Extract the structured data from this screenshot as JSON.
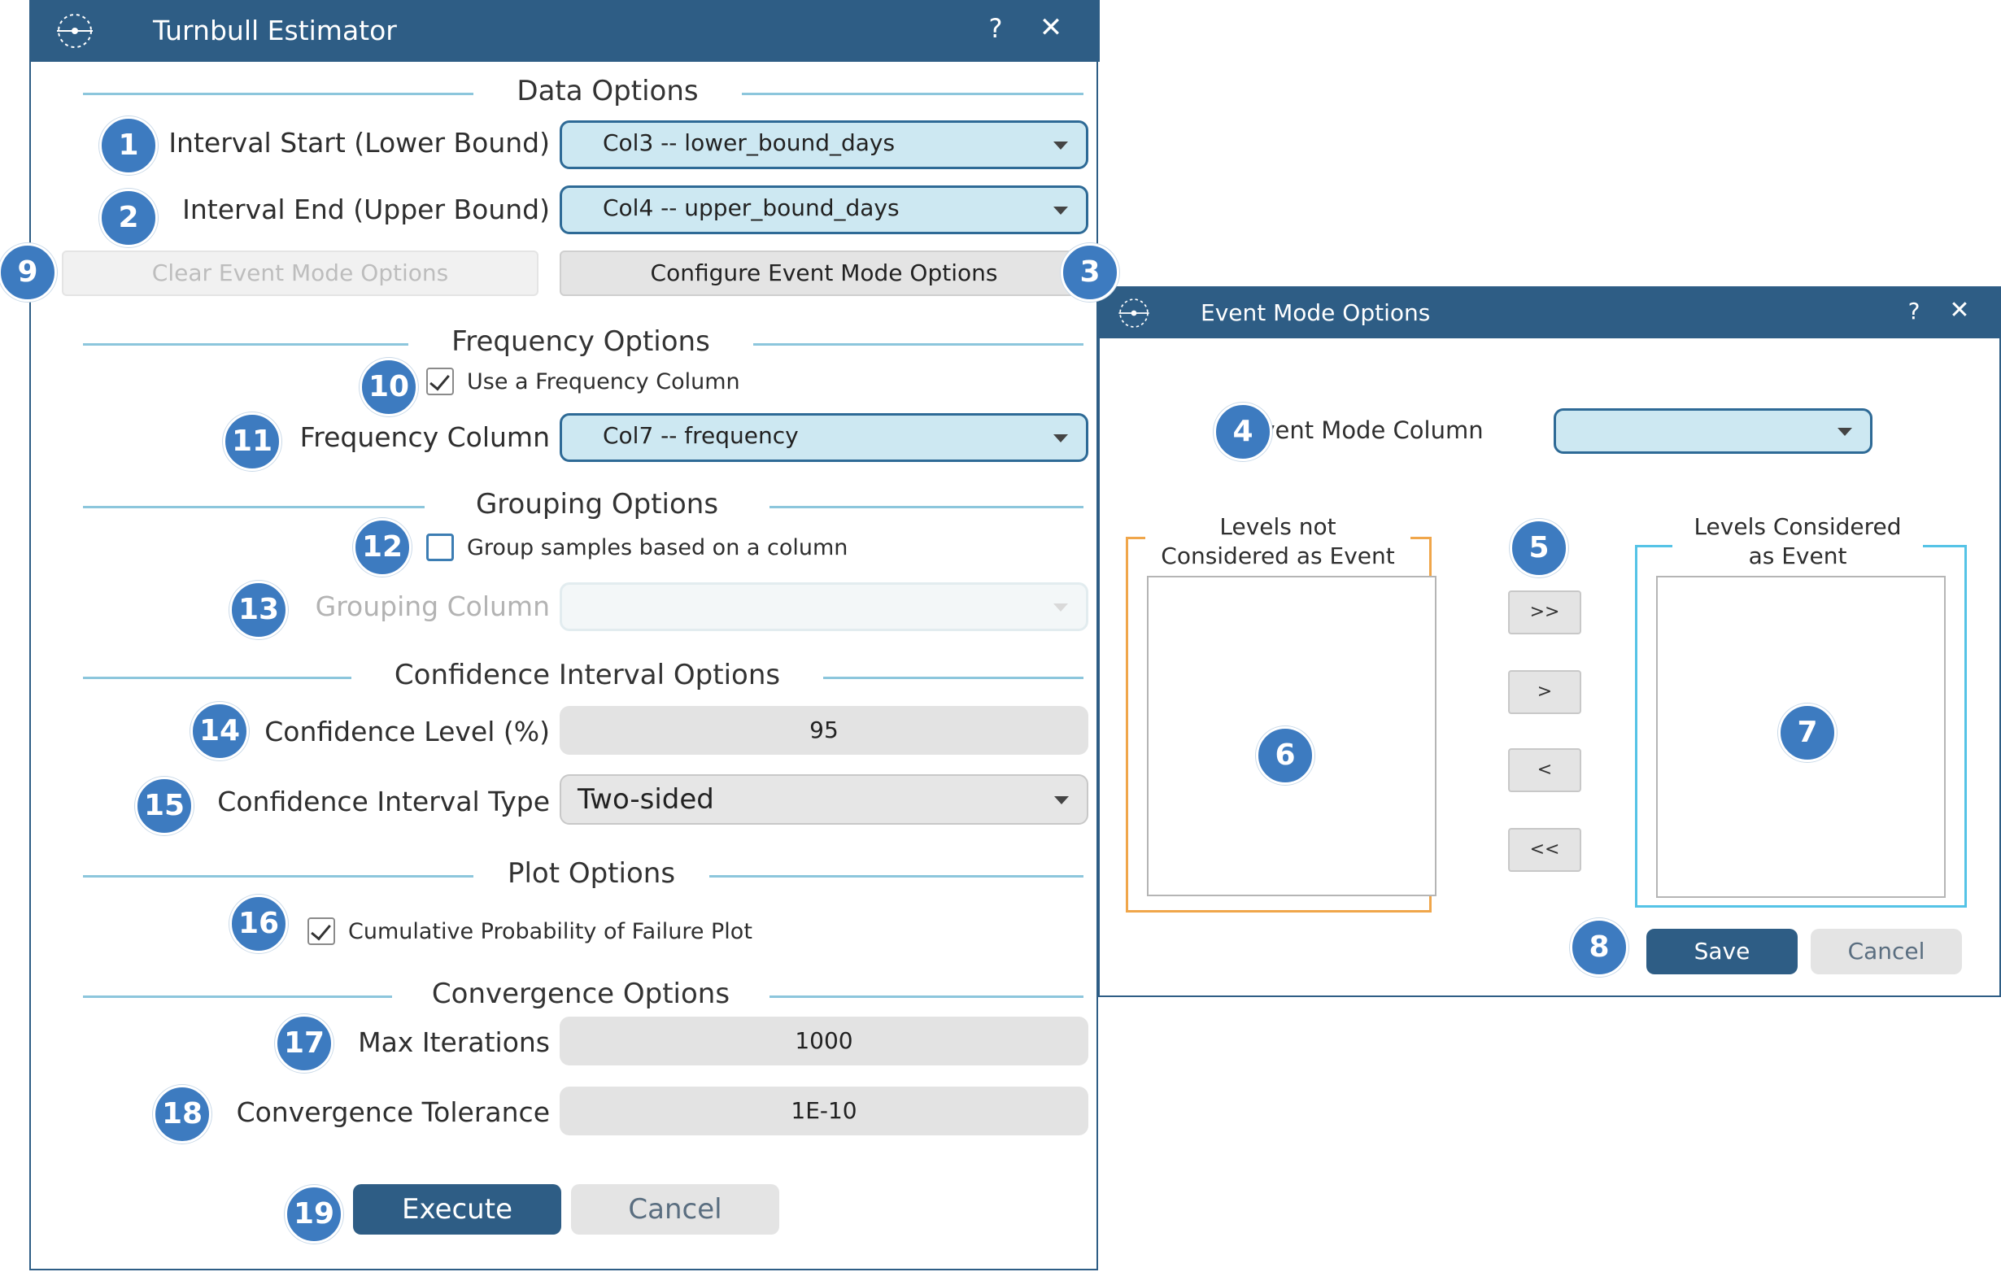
{
  "main_window": {
    "title": "Turnbull Estimator",
    "help_label": "?",
    "close_label": "✕",
    "logo_icon": "logo-circle-icon",
    "data_options": {
      "heading": "Data Options",
      "interval_start_label": "Interval Start (Lower Bound)",
      "interval_start_value": "Col3 -- lower_bound_days",
      "interval_end_label": "Interval End (Upper Bound)",
      "interval_end_value": "Col4 -- upper_bound_days",
      "clear_event_label": "Clear Event Mode Options",
      "configure_event_label": "Configure Event Mode Options"
    },
    "frequency_options": {
      "heading": "Frequency Options",
      "use_frequency_label": "Use a Frequency Column",
      "use_frequency_checked": true,
      "frequency_column_label": "Frequency Column",
      "frequency_column_value": "Col7 -- frequency"
    },
    "grouping_options": {
      "heading": "Grouping Options",
      "group_samples_label": "Group samples based on a column",
      "group_samples_checked": false,
      "grouping_column_label": "Grouping Column",
      "grouping_column_value": ""
    },
    "confidence_options": {
      "heading": "Confidence Interval Options",
      "confidence_level_label": "Confidence Level (%)",
      "confidence_level_value": "95",
      "interval_type_label": "Confidence Interval Type",
      "interval_type_value": "Two-sided"
    },
    "plot_options": {
      "heading": "Plot Options",
      "cumulative_plot_label": "Cumulative Probability of Failure Plot",
      "cumulative_plot_checked": true
    },
    "convergence_options": {
      "heading": "Convergence Options",
      "max_iterations_label": "Max Iterations",
      "max_iterations_value": "1000",
      "tolerance_label": "Convergence Tolerance",
      "tolerance_value": "1E-10"
    },
    "execute_label": "Execute",
    "cancel_label": "Cancel"
  },
  "event_window": {
    "title": "Event Mode Options",
    "help_label": "?",
    "close_label": "✕",
    "event_mode_column_label": "Event Mode Column",
    "event_mode_column_value": "",
    "not_event_title_line1": "Levels not",
    "not_event_title_line2": "Considered as Event",
    "event_title_line1": "Levels Considered",
    "event_title_line2": "as Event",
    "move_all_right_label": ">>",
    "move_right_label": ">",
    "move_left_label": "<",
    "move_all_left_label": "<<",
    "save_label": "Save",
    "cancel_label": "Cancel"
  },
  "badges": {
    "b1": "1",
    "b2": "2",
    "b3": "3",
    "b4": "4",
    "b5": "5",
    "b6": "6",
    "b7": "7",
    "b8": "8",
    "b9": "9",
    "b10": "10",
    "b11": "11",
    "b12": "12",
    "b13": "13",
    "b14": "14",
    "b15": "15",
    "b16": "16",
    "b17": "17",
    "b18": "18",
    "b19": "19"
  },
  "colors": {
    "titlebar": "#2e5d85",
    "badge": "#3d7bc0",
    "combo_fill": "#cde8f2",
    "not_event_frame": "#f0a64a",
    "event_frame": "#55c3e6"
  }
}
